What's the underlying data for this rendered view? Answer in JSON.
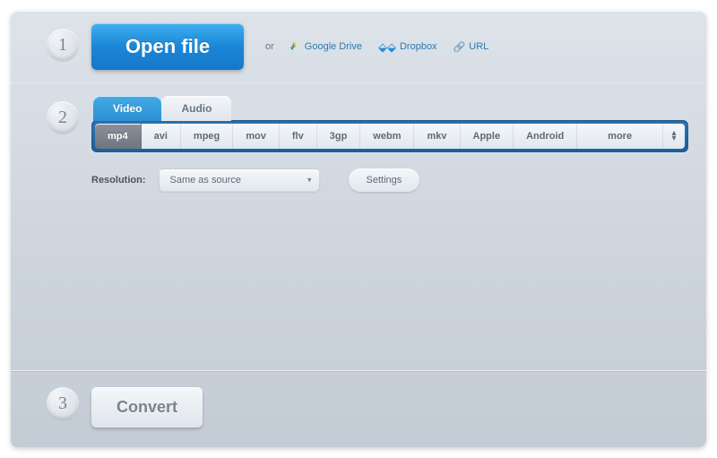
{
  "steps": {
    "one": "1",
    "two": "2",
    "three": "3"
  },
  "step1": {
    "open_label": "Open file",
    "or": "or",
    "google_drive": "Google Drive",
    "dropbox": "Dropbox",
    "url": "URL"
  },
  "step2": {
    "tabs": {
      "video": "Video",
      "audio": "Audio"
    },
    "formats": [
      "mp4",
      "avi",
      "mpeg",
      "mov",
      "flv",
      "3gp",
      "webm",
      "mkv",
      "Apple",
      "Android",
      "more"
    ],
    "active_format": "mp4",
    "resolution_label": "Resolution:",
    "resolution_value": "Same as source",
    "settings": "Settings"
  },
  "step3": {
    "convert": "Convert"
  }
}
